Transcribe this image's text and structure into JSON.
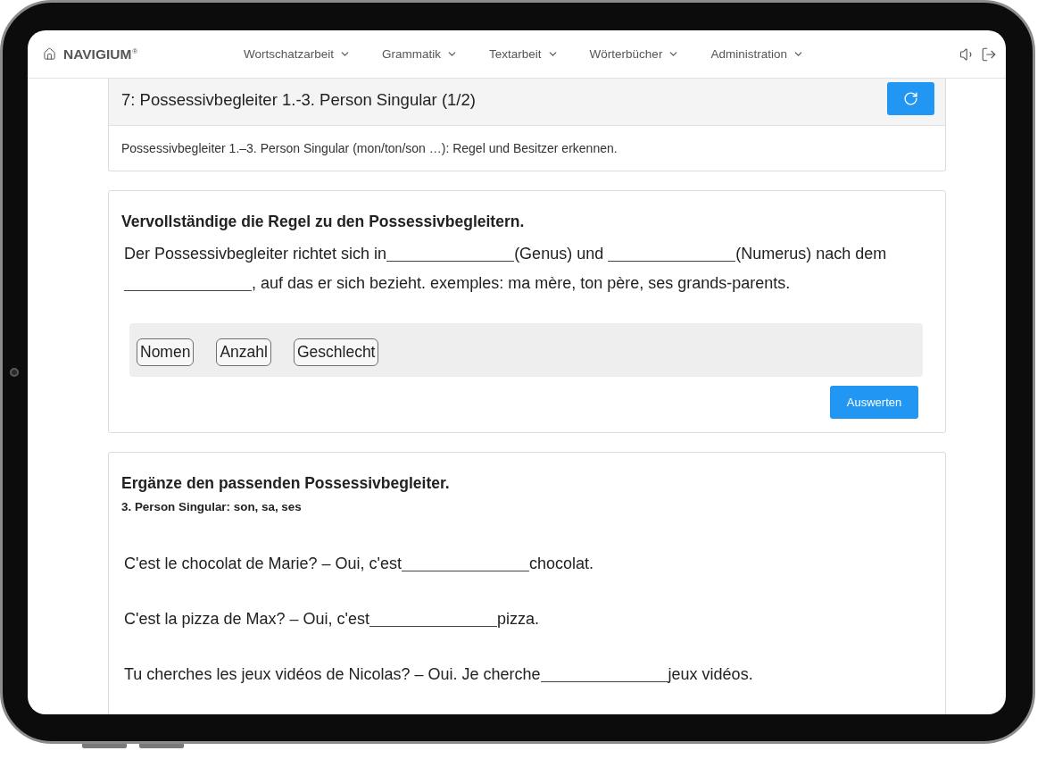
{
  "navbar": {
    "brand": "NAVIGIUM$^{®}$",
    "menu": [
      {
        "label": "Wortschatzarbeit"
      },
      {
        "label": "Grammatik"
      },
      {
        "label": "Textarbeit"
      },
      {
        "label": "Wörterbücher"
      },
      {
        "label": "Administration"
      }
    ]
  },
  "lesson": {
    "title": "7: Possessivbegleiter 1.-3. Person Singular (1/2)",
    "description": "Possessivbegleiter 1.–3. Person Singular (mon/ton/son …): Regel und Besitzer erkennen."
  },
  "exercises": [
    {
      "kind": "word_bank_cloze",
      "instruction": "Vervollständige die Regel zu den Possessivbegleitern.",
      "parts": [
        {
          "kind": "text",
          "text": "Der Possessivbegleiter richtet sich in"
        },
        {
          "kind": "blank"
        },
        {
          "kind": "text",
          "text": "(Genus) und "
        },
        {
          "kind": "blank"
        },
        {
          "kind": "text",
          "text": "(Numerus) nach dem "
        },
        {
          "kind": "blank"
        },
        {
          "kind": "text",
          "text": ", auf das er sich bezieht. exemples: ma mère, ton père, ses grands-parents."
        }
      ],
      "word_bank": [
        {
          "label": "Nomen"
        },
        {
          "label": "Anzahl"
        },
        {
          "label": "Geschlecht"
        }
      ],
      "submit": "Auswerten"
    },
    {
      "kind": "sentence_cloze",
      "instruction": "Ergänze den passenden Possessivbegleiter.",
      "hint": "3. Person Singular: son, sa, ses",
      "sentences": [
        {
          "parts": [
            {
              "kind": "text",
              "text": "C'est le chocolat de Marie? – Oui, c'est"
            },
            {
              "kind": "blank"
            },
            {
              "kind": "text",
              "text": "chocolat."
            }
          ]
        },
        {
          "parts": [
            {
              "kind": "text",
              "text": "C'est la pizza de Max? – Oui, c'est"
            },
            {
              "kind": "blank"
            },
            {
              "kind": "text",
              "text": "pizza."
            }
          ]
        },
        {
          "parts": [
            {
              "kind": "text",
              "text": "Tu cherches les jeux vidéos de Nicolas? – Oui. Je cherche"
            },
            {
              "kind": "blank"
            },
            {
              "kind": "text",
              "text": "jeux vidéos."
            }
          ]
        }
      ]
    }
  ]
}
